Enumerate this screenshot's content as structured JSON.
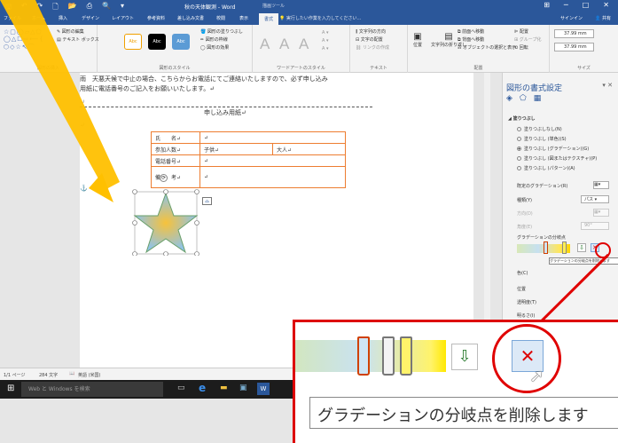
{
  "titlebar": {
    "document": "秋の天体観測 - Word",
    "context": "描画ツール",
    "minimize": "─",
    "maximize": "□",
    "close": "✕"
  },
  "tabs": [
    "ファイル",
    "ホーム",
    "挿入",
    "デザイン",
    "レイアウト",
    "参考資料",
    "差し込み文書",
    "校閲",
    "表示",
    "書式"
  ],
  "active_tab": "書式",
  "tell_me": "実行したい作業を入力してください...",
  "signin": "サインイン",
  "share": "共有",
  "ribbon": {
    "insert_shapes": {
      "edit_shape": "図形の編集",
      "text_box": "テキスト ボックス",
      "group": "図形の挿入"
    },
    "shape_styles": {
      "sample": "Abc",
      "fill": "図形の塗りつぶし",
      "outline": "図形の枠線",
      "effects": "図形の効果",
      "group": "図形のスタイル"
    },
    "wordart": {
      "letter": "A",
      "group": "ワードアートのスタイル"
    },
    "text": {
      "direction": "文字列の方向",
      "align": "文字の配置",
      "link": "リンクの作成",
      "group": "テキスト"
    },
    "arrange": {
      "position": "位置",
      "wrap": "文字列の折り返し",
      "forward": "前面へ移動",
      "backward": "背面へ移動",
      "selection": "オブジェクトの選択と表示",
      "align": "配置",
      "group_btn": "グループ化",
      "rotate": "回転",
      "group": "配置"
    },
    "size": {
      "height": "37.99 mm",
      "width": "37.99 mm",
      "group": "サイズ"
    }
  },
  "document": {
    "line1": "雨　天悪天候で中止の場合、こちらからお電話にてご連絡いたしますので、必ず申し込み",
    "line2": "用紙に電話番号のご記入をお願いいたします。↵",
    "return_mark": "↵",
    "form_title": "申し込み用紙↵",
    "form": [
      {
        "label": "氏　　名↵",
        "cells": [
          "↵",
          "",
          ""
        ]
      },
      {
        "label": "参加人数↵",
        "cells": [
          "子供↵",
          "大人↵",
          ""
        ]
      },
      {
        "label": "電話番号↵",
        "cells": [
          "↵",
          "",
          ""
        ]
      },
      {
        "label": "備　　考↵",
        "cells": [
          "↵",
          "",
          ""
        ]
      }
    ]
  },
  "pane": {
    "title": "図形の書式設定",
    "section": "塗りつぶし",
    "options": [
      {
        "label": "塗りつぶしなし(N)",
        "selected": false
      },
      {
        "label": "塗りつぶし (単色)(S)",
        "selected": false
      },
      {
        "label": "塗りつぶし (グラデーション)(G)",
        "selected": true
      },
      {
        "label": "塗りつぶし (図またはテクスチャ)(P)",
        "selected": false
      },
      {
        "label": "塗りつぶし (パターン)(A)",
        "selected": false
      }
    ],
    "preset": "既定のグラデーション(R)",
    "type": "種類(Y)",
    "type_value": "パス",
    "direction": "方向(D)",
    "angle": "角度(E)",
    "angle_value": "90°",
    "stops_label": "グラデーションの分岐点",
    "color": "色(C)",
    "position": "位置",
    "transparency": "透明度(T)",
    "brightness": "明るさ(I)",
    "tooltip": "グラデーションの分岐点を削除します"
  },
  "status": {
    "page": "1/1 ページ",
    "words": "284 文字",
    "lang": "英語 (米国)"
  },
  "taskbar": {
    "search": "Web と Windows を検索"
  },
  "zoom": {
    "tooltip": "グラデーションの分岐点を削除します"
  },
  "colors": {
    "word_blue": "#2b579a",
    "callout_red": "#e00000",
    "highlight_yellow": "#ffc000",
    "table_border": "#ed7d31"
  }
}
